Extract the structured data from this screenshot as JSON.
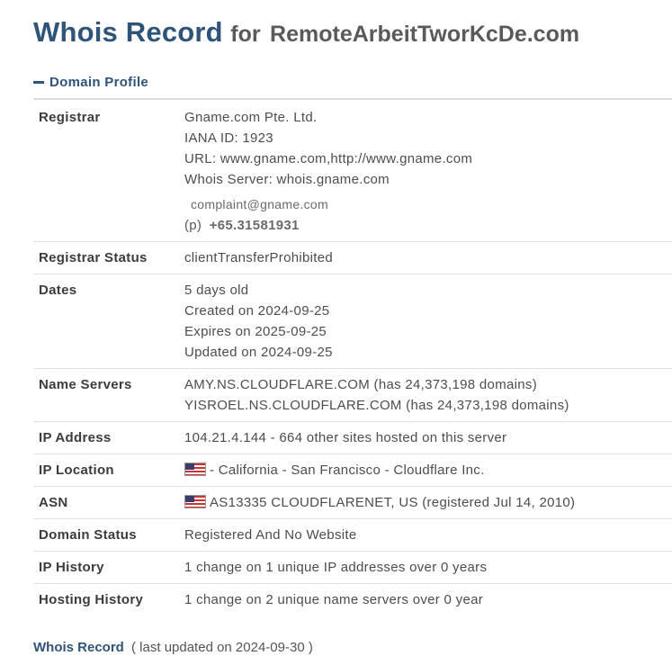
{
  "header": {
    "title_main": "Whois Record",
    "title_for": "for",
    "domain": "RemoteArbeitTworKcDe.com"
  },
  "section": {
    "label": "Domain Profile",
    "icon": "minus-icon"
  },
  "rows": [
    {
      "key": "Registrar",
      "lines": [
        "Gname.com Pte. Ltd.",
        "IANA ID: 1923",
        "URL: www.gname.com,http://www.gname.com",
        "Whois Server: whois.gname.com",
        "complaint@gname.com",
        "(p)",
        "+65.31581931"
      ]
    },
    {
      "key": "Registrar Status",
      "lines": [
        "clientTransferProhibited"
      ]
    },
    {
      "key": "Dates",
      "lines": [
        "5 days old",
        "Created on 2024-09-25",
        "Expires on 2025-09-25",
        "Updated on 2024-09-25"
      ]
    },
    {
      "key": "Name Servers",
      "lines": [
        "AMY.NS.CLOUDFLARE.COM (has 24,373,198 domains)",
        "YISROEL.NS.CLOUDFLARE.COM (has 24,373,198 domains)"
      ]
    },
    {
      "key": "IP Address",
      "lines": [
        "104.21.4.144 - 664 other sites hosted on this server"
      ]
    },
    {
      "key": "IP Location",
      "lines": [
        "- California - San Francisco - Cloudflare Inc."
      ]
    },
    {
      "key": "ASN",
      "lines": [
        "AS13335 CLOUDFLARENET, US (registered Jul 14, 2010)"
      ]
    },
    {
      "key": "Domain Status",
      "lines": [
        "Registered And No Website"
      ]
    },
    {
      "key": "IP History",
      "lines": [
        "1 change on 1 unique IP addresses over 0 years"
      ]
    },
    {
      "key": "Hosting History",
      "lines": [
        "1 change on 2 unique name servers over 0 year"
      ]
    }
  ],
  "footer": {
    "link": "Whois Record",
    "updated": "( last updated on 2024-09-30 )"
  },
  "icons": {
    "flag": "us-flag-icon"
  },
  "colors": {
    "accent": "#2f5479",
    "text": "#4d4d4d",
    "divider": "#e2e2e2"
  }
}
